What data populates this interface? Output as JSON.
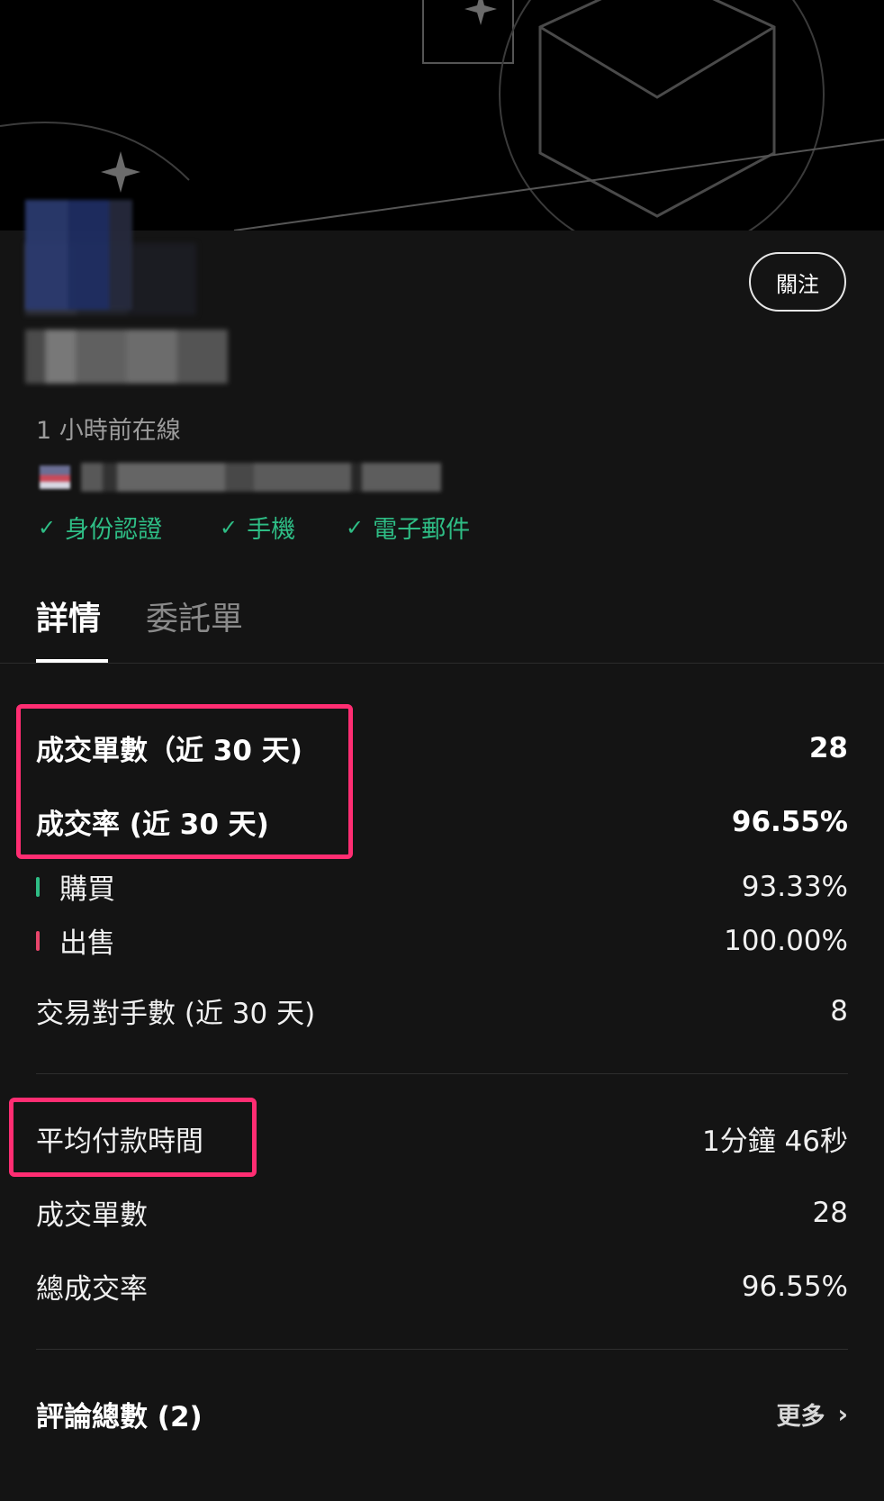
{
  "profile": {
    "follow_label": "關注",
    "online_status": "1 小時前在線",
    "verifications": [
      {
        "label": "身份認證"
      },
      {
        "label": "手機"
      },
      {
        "label": "電子郵件"
      }
    ]
  },
  "tabs": [
    {
      "label": "詳情",
      "active": true
    },
    {
      "label": "委託單",
      "active": false
    }
  ],
  "stats": {
    "orders_30d": {
      "label": "成交單數（近 30 天)",
      "value": "28"
    },
    "completion_30d": {
      "label": "成交率 (近 30 天)",
      "value": "96.55%"
    },
    "buy": {
      "label": "購買",
      "value": "93.33%"
    },
    "sell": {
      "label": "出售",
      "value": "100.00%"
    },
    "counterparties_30d": {
      "label": "交易對手數 (近 30 天)",
      "value": "8"
    },
    "avg_payment_time": {
      "label": "平均付款時間",
      "value": "1分鐘 46秒"
    },
    "total_orders": {
      "label": "成交單數",
      "value": "28"
    },
    "total_completion": {
      "label": "總成交率",
      "value": "96.55%"
    }
  },
  "reviews": {
    "label": "評論總數 (2)",
    "more_label": "更多"
  },
  "colors": {
    "background": "#141414",
    "accent_green": "#2ebd85",
    "accent_red": "#e8456b",
    "highlight": "#ff2d72"
  }
}
